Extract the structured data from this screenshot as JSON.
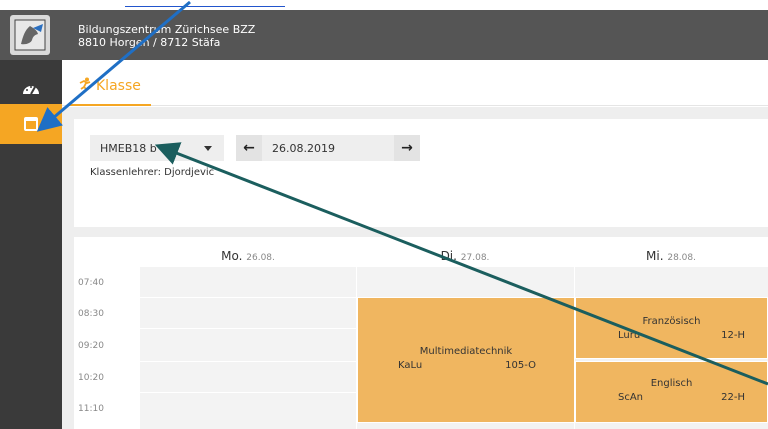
{
  "header": {
    "org_name": "Bildungszentrum Zürichsee BZZ",
    "org_location": "8810 Horgen / 8712 Stäfa",
    "logo_icon": "lion-coat-of-arms-icon"
  },
  "sidebar": {
    "items": [
      {
        "name": "dashboard",
        "icon": "gauge-icon"
      },
      {
        "name": "calendar",
        "icon": "calendar-icon",
        "active": true
      }
    ]
  },
  "tab": {
    "label": "Klasse",
    "icon": "person-running-icon"
  },
  "filter": {
    "class_value": "HMEB18 b",
    "date_value": "26.08.2019",
    "class_teacher": "Klassenlehrer: Djordjevic"
  },
  "timetable": {
    "days": [
      {
        "dow": "Mo.",
        "date": "26.08."
      },
      {
        "dow": "Di.",
        "date": "27.08."
      },
      {
        "dow": "Mi.",
        "date": "28.08."
      }
    ],
    "times": [
      "07:40",
      "08:30",
      "09:20",
      "10:20",
      "11:10"
    ],
    "lessons": [
      {
        "subject": "Multimediatechnik",
        "teacher": "KaLu",
        "room": "105-O"
      },
      {
        "subject": "Französisch",
        "teacher": "Luru",
        "room": "12-H"
      },
      {
        "subject": "Englisch",
        "teacher": "ScAn",
        "room": "22-H"
      }
    ]
  },
  "colors": {
    "accent": "#f5a623",
    "header_bg": "#555555",
    "sidebar_bg": "#3a3a3a",
    "lesson_bg": "#f0b660",
    "arrow_blue": "#1f6fc5",
    "arrow_green": "#1b5e5e"
  }
}
